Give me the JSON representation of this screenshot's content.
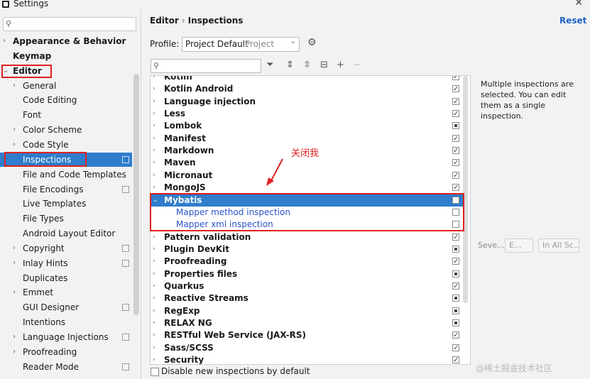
{
  "window": {
    "title": "Settings",
    "close_glyph": "✕"
  },
  "sidebar": {
    "search_placeholder": "",
    "items": [
      {
        "label": "Appearance & Behavior",
        "bold": true,
        "arrow": "›",
        "level": 0
      },
      {
        "label": "Keymap",
        "bold": true,
        "arrow": "",
        "level": 0
      },
      {
        "label": "Editor",
        "bold": true,
        "arrow": "⌄",
        "level": 0
      },
      {
        "label": "General",
        "arrow": "›",
        "level": 1
      },
      {
        "label": "Code Editing",
        "arrow": "",
        "level": 1
      },
      {
        "label": "Font",
        "arrow": "",
        "level": 1
      },
      {
        "label": "Color Scheme",
        "arrow": "›",
        "level": 1
      },
      {
        "label": "Code Style",
        "arrow": "›",
        "level": 1
      },
      {
        "label": "Inspections",
        "arrow": "",
        "level": 1,
        "selected": true,
        "project": true
      },
      {
        "label": "File and Code Templates",
        "arrow": "",
        "level": 1
      },
      {
        "label": "File Encodings",
        "arrow": "",
        "level": 1,
        "project": true
      },
      {
        "label": "Live Templates",
        "arrow": "",
        "level": 1
      },
      {
        "label": "File Types",
        "arrow": "",
        "level": 1
      },
      {
        "label": "Android Layout Editor",
        "arrow": "",
        "level": 1
      },
      {
        "label": "Copyright",
        "arrow": "›",
        "level": 1,
        "project": true
      },
      {
        "label": "Inlay Hints",
        "arrow": "›",
        "level": 1,
        "project": true
      },
      {
        "label": "Duplicates",
        "arrow": "",
        "level": 1
      },
      {
        "label": "Emmet",
        "arrow": "›",
        "level": 1
      },
      {
        "label": "GUI Designer",
        "arrow": "",
        "level": 1,
        "project": true
      },
      {
        "label": "Intentions",
        "arrow": "",
        "level": 1
      },
      {
        "label": "Language Injections",
        "arrow": "›",
        "level": 1,
        "project": true
      },
      {
        "label": "Proofreading",
        "arrow": "›",
        "level": 1
      },
      {
        "label": "Reader Mode",
        "arrow": "",
        "level": 1,
        "project": true
      }
    ]
  },
  "header": {
    "crumb1": "Editor",
    "sep": "›",
    "crumb2": "Inspections",
    "reset": "Reset"
  },
  "profile": {
    "label": "Profile:",
    "value": "Project Default",
    "scope": "Project"
  },
  "inspections": [
    {
      "label": "Kotlin",
      "state": "checked"
    },
    {
      "label": "Kotlin Android",
      "state": "checked"
    },
    {
      "label": "Language injection",
      "state": "checked"
    },
    {
      "label": "Less",
      "state": "checked"
    },
    {
      "label": "Lombok",
      "state": "partial"
    },
    {
      "label": "Manifest",
      "state": "checked"
    },
    {
      "label": "Markdown",
      "state": "checked"
    },
    {
      "label": "Maven",
      "state": "checked"
    },
    {
      "label": "Micronaut",
      "state": "checked"
    },
    {
      "label": "MongoJS",
      "state": "checked"
    },
    {
      "label": "Mybatis",
      "state": "unchecked",
      "selected": true,
      "expanded": true
    },
    {
      "label": "Mapper method inspection",
      "state": "unchecked",
      "child": true
    },
    {
      "label": "Mapper xml inspection",
      "state": "unchecked",
      "child": true
    },
    {
      "label": "Pattern validation",
      "state": "checked"
    },
    {
      "label": "Plugin DevKit",
      "state": "partial"
    },
    {
      "label": "Proofreading",
      "state": "checked"
    },
    {
      "label": "Properties files",
      "state": "partial"
    },
    {
      "label": "Quarkus",
      "state": "checked"
    },
    {
      "label": "Reactive Streams",
      "state": "partial"
    },
    {
      "label": "RegExp",
      "state": "partial"
    },
    {
      "label": "RELAX NG",
      "state": "partial"
    },
    {
      "label": "RESTful Web Service (JAX-RS)",
      "state": "checked"
    },
    {
      "label": "Sass/SCSS",
      "state": "checked"
    },
    {
      "label": "Security",
      "state": "checked"
    }
  ],
  "description": "Multiple inspections are selected. You can edit them as a single inspection.",
  "severity": {
    "label": "Seve...",
    "value": "E...",
    "scope": "In All Sc..."
  },
  "footer": {
    "disable_label": "Disable new inspections by default"
  },
  "annotation": "关闭我",
  "watermark": "@稀土掘金技术社区",
  "colors": {
    "selection": "#2f7dcc",
    "link": "#2b53c8",
    "annotation": "#e02020"
  }
}
